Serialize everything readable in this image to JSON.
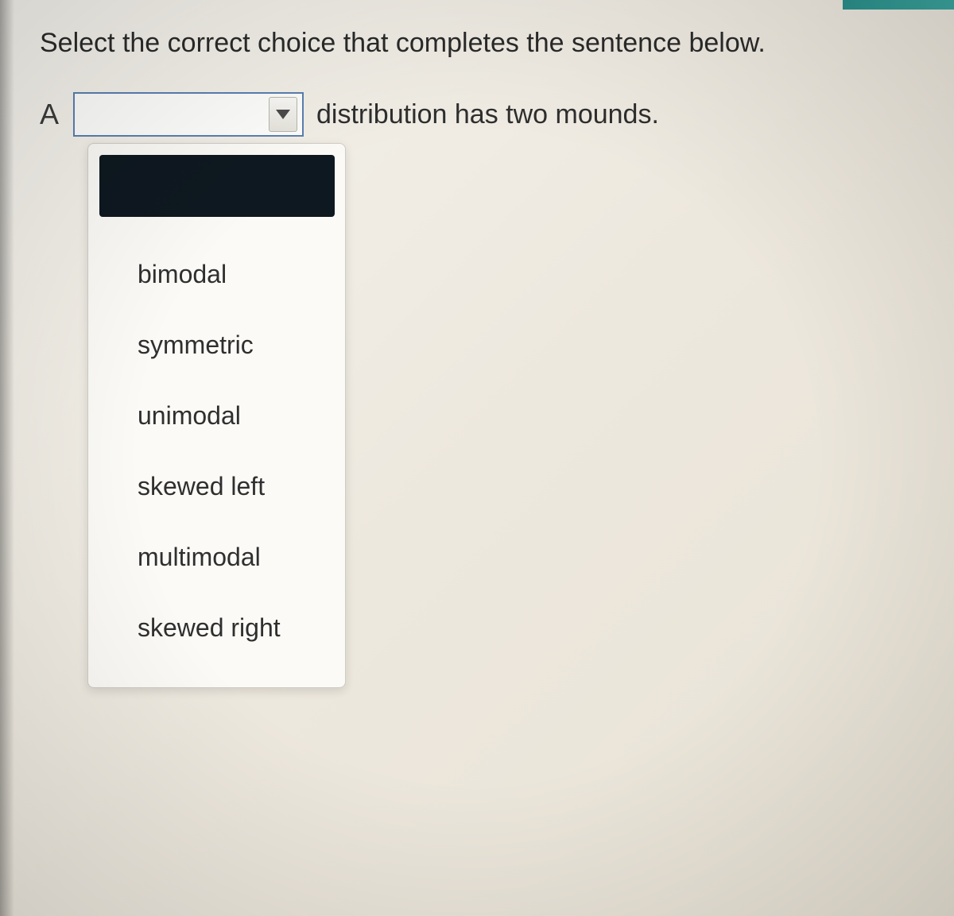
{
  "prompt": "Select the correct choice that completes the sentence below.",
  "sentence": {
    "prefix": "A",
    "suffix": "distribution has two mounds."
  },
  "dropdown": {
    "selected": "",
    "options": [
      "bimodal",
      "symmetric",
      "unimodal",
      "skewed left",
      "multimodal",
      "skewed right"
    ]
  }
}
